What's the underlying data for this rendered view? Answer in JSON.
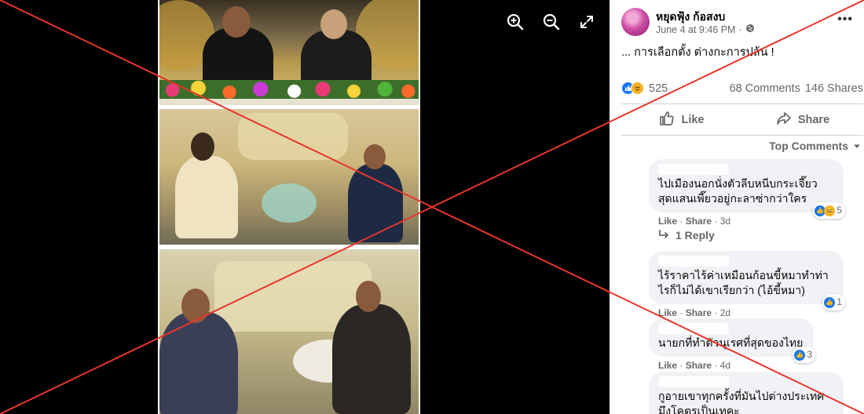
{
  "post": {
    "author": "หยุดฟุ้ง ก้อสงบ",
    "date": "June 4 at 9:46 PM",
    "separator": "·",
    "text": "... การเลือกตั้ง ต่างกะการปล้น !",
    "reaction_count": "525",
    "comments_count": "68 Comments",
    "shares_count": "146 Shares"
  },
  "actions": {
    "like": "Like",
    "share": "Share"
  },
  "sort_label": "Top Comments",
  "comments": [
    {
      "text": "ไปเมืองนอกนั่งตัวลีบหนีบกระเจี๊ยว สุดแสนเพี๊ยวอยู่กะลาซ่ากว่าใคร",
      "like": "Like",
      "share": "Share",
      "time": "3d",
      "reaction_count": "5",
      "sep": " · "
    },
    {
      "text": "ไร้ราคาไร้ค่าเหมือนก้อนขี้หมาทำท่าไรก็ไม่ได้เขาเรียกว่า (ไอ้ขี้หมา)",
      "like": "Like",
      "share": "Share",
      "time": "2d",
      "reaction_count": "1",
      "sep": " · "
    },
    {
      "text": "นายกที่ทำตัวนุเรศที่สุดของไทย",
      "like": "Like",
      "share": "Share",
      "time": "4d",
      "reaction_count": "3",
      "sep": " · "
    },
    {
      "text": "กูอายเขาทุกครั้งที่มันไปต่างประเทศ มึงโคตรเป็นเทคะ",
      "like": "",
      "share": "",
      "time": "",
      "reaction_count": "",
      "sep": ""
    }
  ],
  "reply_link": "1 Reply",
  "icons": {
    "zoom_in": "zoom-in-icon",
    "zoom_out": "zoom-out-icon",
    "fullscreen": "fullscreen-icon",
    "globe": "globe-icon",
    "more": "more-icon"
  },
  "colors": {
    "accent": "#1877f2",
    "overlay_x": "#e8362b",
    "viewer_bg": "#000000"
  }
}
